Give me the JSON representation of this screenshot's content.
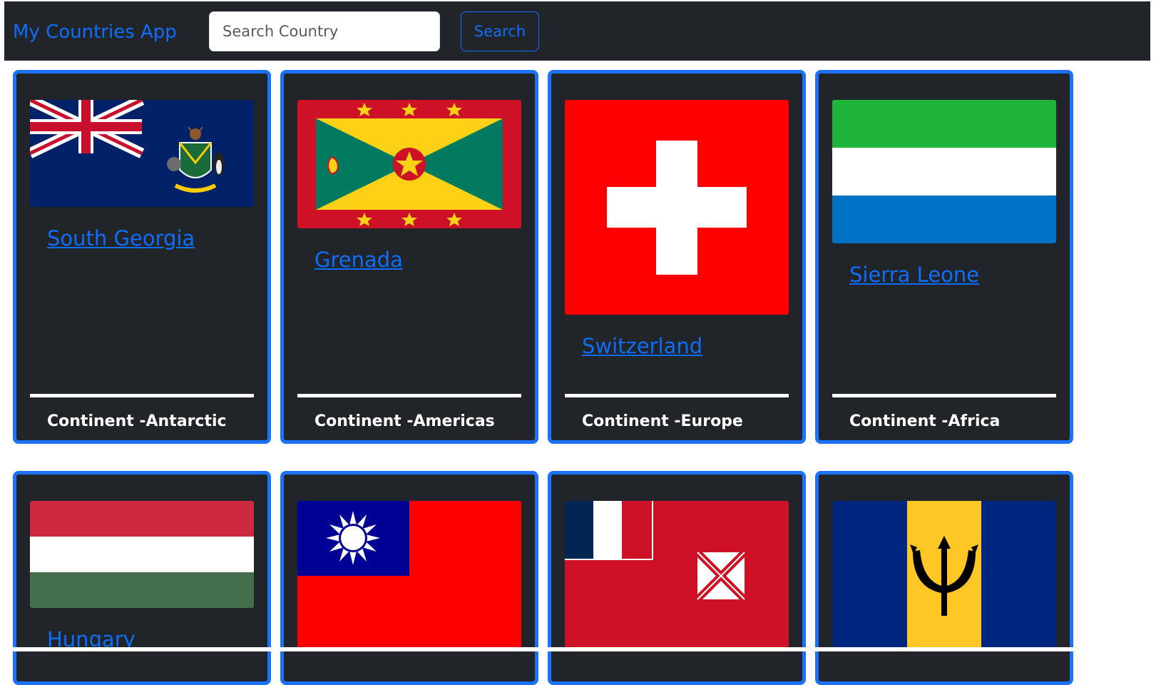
{
  "app": {
    "brand": "My Countries App",
    "search": {
      "placeholder": "Search Country",
      "value": ""
    },
    "search_button": "Search"
  },
  "countries": [
    {
      "name": "South Georgia",
      "continent": "Continent -Antarctic",
      "flag": "south-georgia-flag"
    },
    {
      "name": "Grenada",
      "continent": "Continent -Americas",
      "flag": "grenada-flag"
    },
    {
      "name": "Switzerland",
      "continent": "Continent -Europe",
      "flag": "switzerland-flag"
    },
    {
      "name": "Sierra Leone",
      "continent": "Continent -Africa",
      "flag": "sierra-leone-flag"
    },
    {
      "name": "Hungary",
      "flag": "hungary-flag"
    },
    {
      "name": "",
      "flag": "taiwan-flag"
    },
    {
      "name": "",
      "flag": "wallis-and-futuna-flag"
    },
    {
      "name": "",
      "flag": "barbados-flag"
    }
  ],
  "colors": {
    "navbar_bg": "#212529",
    "card_bg": "#212529",
    "accent": "#0d6efd",
    "card_border": "#1a72ff"
  }
}
